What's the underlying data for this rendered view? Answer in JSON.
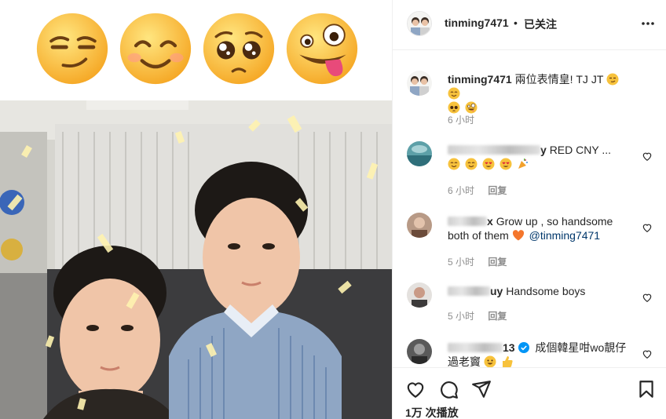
{
  "post": {
    "views_label": "1万 次播放",
    "emoji_strip": [
      "smirking-face",
      "smiling-face-with-smiling-eyes",
      "pleading-face",
      "zany-face"
    ]
  },
  "header": {
    "username": "tinming7471",
    "separator": "•",
    "follow_status": "已关注"
  },
  "caption": {
    "username": "tinming7471",
    "text": "兩位表情皇! TJ JT",
    "emojis": [
      "smirking-face",
      "smiling-face-with-smiling-eyes",
      "pleading-face",
      "zany-face"
    ],
    "time": "6 小时"
  },
  "comments": [
    {
      "user_visible_suffix": "y",
      "text": "RED CNY ...",
      "emojis": [
        "smiling-face-with-smiling-eyes",
        "smiling-face-with-smiling-eyes",
        "heart-eyes-face",
        "heart-eyes-face",
        "party-popper"
      ],
      "time": "6 小时",
      "reply_label": "回复"
    },
    {
      "user_visible_suffix": "x",
      "text": "Grow up , so handsome both of them",
      "emoji": "orange-heart",
      "mention": "@tinming7471",
      "time": "5 小时",
      "reply_label": "回复"
    },
    {
      "user_visible_suffix": "uy",
      "text": "Handsome boys",
      "time": "5 小时",
      "reply_label": "回复"
    },
    {
      "user_visible_suffix": "13",
      "text": "成個韓星咁wo靚仔過老竇",
      "emojis": [
        "grinning-face",
        "thumbs-up"
      ],
      "verified": true
    }
  ],
  "icons": {
    "more": "more-horizontal-icon",
    "like": "heart-icon",
    "comment": "comment-icon",
    "share": "share-icon",
    "save": "bookmark-icon"
  },
  "colors": {
    "text": "#262626",
    "secondary": "#8e8e8e",
    "link": "#00376b",
    "border": "#efefef",
    "verified": "#0095f6"
  }
}
